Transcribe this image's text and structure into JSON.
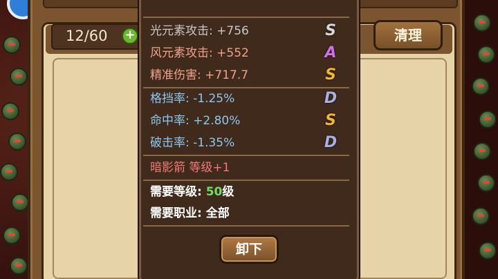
{
  "inventory": {
    "slot_count": "12/60",
    "add_symbol": "+",
    "clear_label": "清理"
  },
  "tooltip": {
    "header_partial": "",
    "stats": [
      {
        "label": "光元素攻击: +756",
        "grade": "S",
        "color": "#c8c8c8",
        "grade_color": "#d8d8d8"
      },
      {
        "label": "风元素攻击: +552",
        "grade": "A",
        "color": "#f0a28a",
        "grade_color": "#d070e8"
      },
      {
        "label": "精准伤害: +717.7",
        "grade": "S",
        "color": "#f0a28a",
        "grade_color": "#f2b636"
      }
    ],
    "sub_stats": [
      {
        "label": "格挡率: -1.25%",
        "grade": "D",
        "color": "#8cc8f0",
        "grade_color": "#a8b0e0"
      },
      {
        "label": "命中率: +2.80%",
        "grade": "S",
        "color": "#8cc8f0",
        "grade_color": "#f2b636"
      },
      {
        "label": "破击率: -1.35%",
        "grade": "D",
        "color": "#8cc8f0",
        "grade_color": "#a8b0e0"
      }
    ],
    "skill_bonus": "暗影箭 等级+1",
    "req_level_prefix": "需要等级: ",
    "req_level_value": "50",
    "req_level_suffix": "级",
    "req_class": "需要职业: 全部",
    "unequip_label": "卸下"
  },
  "colors": {
    "skill_bonus": "#f07a78",
    "req_text": "#ffffff",
    "req_level_value": "#6ee060",
    "panel_bg": "#3f2a1c",
    "accent": "#7a5530"
  }
}
